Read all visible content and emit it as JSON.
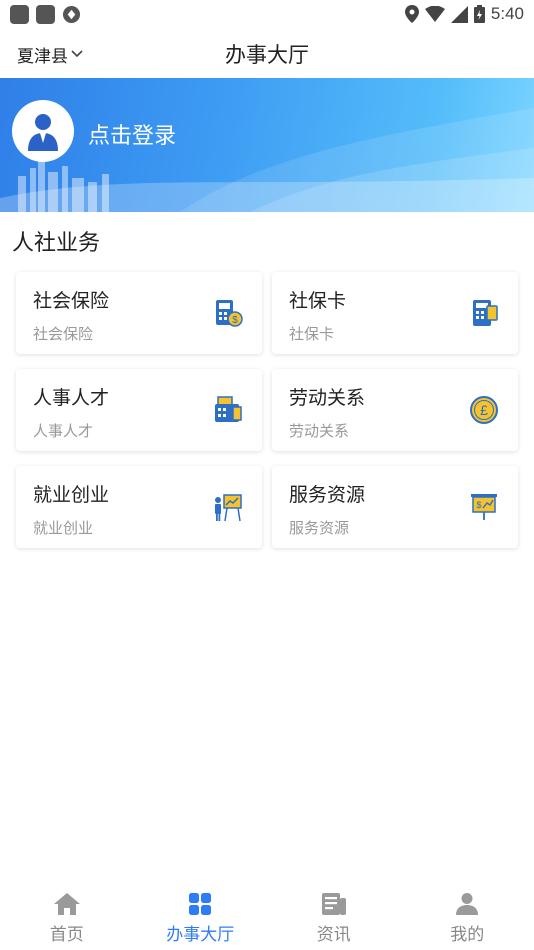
{
  "status_bar": {
    "time": "5:40"
  },
  "header": {
    "region": "夏津县",
    "title": "办事大厅"
  },
  "banner": {
    "login_text": "点击登录"
  },
  "section": {
    "title": "人社业务"
  },
  "services": [
    {
      "title": "社会保险",
      "subtitle": "社会保险",
      "icon": "pos-terminal-icon"
    },
    {
      "title": "社保卡",
      "subtitle": "社保卡",
      "icon": "card-reader-icon"
    },
    {
      "title": "人事人才",
      "subtitle": "人事人才",
      "icon": "printer-icon"
    },
    {
      "title": "劳动关系",
      "subtitle": "劳动关系",
      "icon": "pound-coin-icon"
    },
    {
      "title": "就业创业",
      "subtitle": "就业创业",
      "icon": "presentation-person-icon"
    },
    {
      "title": "服务资源",
      "subtitle": "服务资源",
      "icon": "finance-board-icon"
    }
  ],
  "bottom_nav": [
    {
      "label": "首页",
      "icon": "home-icon",
      "active": false
    },
    {
      "label": "办事大厅",
      "icon": "grid-icon",
      "active": true
    },
    {
      "label": "资讯",
      "icon": "news-icon",
      "active": false
    },
    {
      "label": "我的",
      "icon": "user-icon",
      "active": false
    }
  ],
  "colors": {
    "accent": "#2e7cf6",
    "banner_start": "#2f7fe8",
    "banner_end": "#7cd5ff",
    "icon_blue": "#2e6fc6",
    "icon_yellow": "#f5c32c"
  }
}
